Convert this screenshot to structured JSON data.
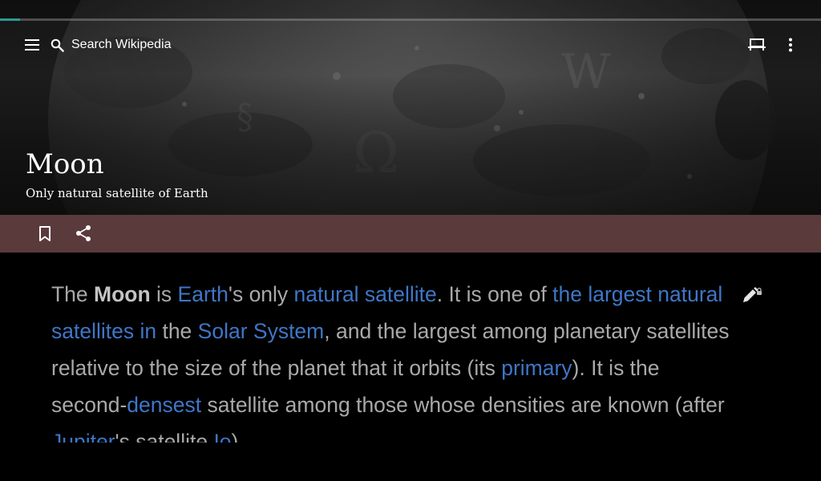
{
  "toolbar": {
    "search_placeholder": "Search Wikipedia",
    "menu_icon": "hamburger-menu-icon",
    "search_icon": "search-icon",
    "reading_list_icon": "reading-list-icon",
    "overflow_icon": "more-vert-icon"
  },
  "page": {
    "title": "Moon",
    "description": "Only natural satellite of Earth",
    "load_progress": 0.024
  },
  "actions": {
    "bookmark_icon": "bookmark-icon",
    "share_icon": "share-icon",
    "edit_icon": "edit-locked-icon"
  },
  "article": {
    "t1": "The ",
    "bold_moon": "Moon",
    "t2": " is ",
    "link_earth": "Earth",
    "t3": "'s only ",
    "link_natural_satellite": "natural satellite",
    "t4": ". It is one of ",
    "link_largest": "the largest natural satellites in",
    "t5": " the ",
    "link_solar_system": "Solar System",
    "t6": ", and the largest among planetary satellites relative to the size of the planet that it orbits (its ",
    "link_primary": "primary",
    "t7": "). It is the second-",
    "link_densest": "densest",
    "t8": " satellite among those whose densities are known (after ",
    "link_jupiter": "Jupiter",
    "t9": "'s satellite ",
    "link_io": "Io",
    "t10": ")."
  },
  "colors": {
    "action_bar": "#5a3a3b",
    "link": "#3f76c7",
    "body_text": "#a9a9a9",
    "progress": "#2d9a93"
  }
}
